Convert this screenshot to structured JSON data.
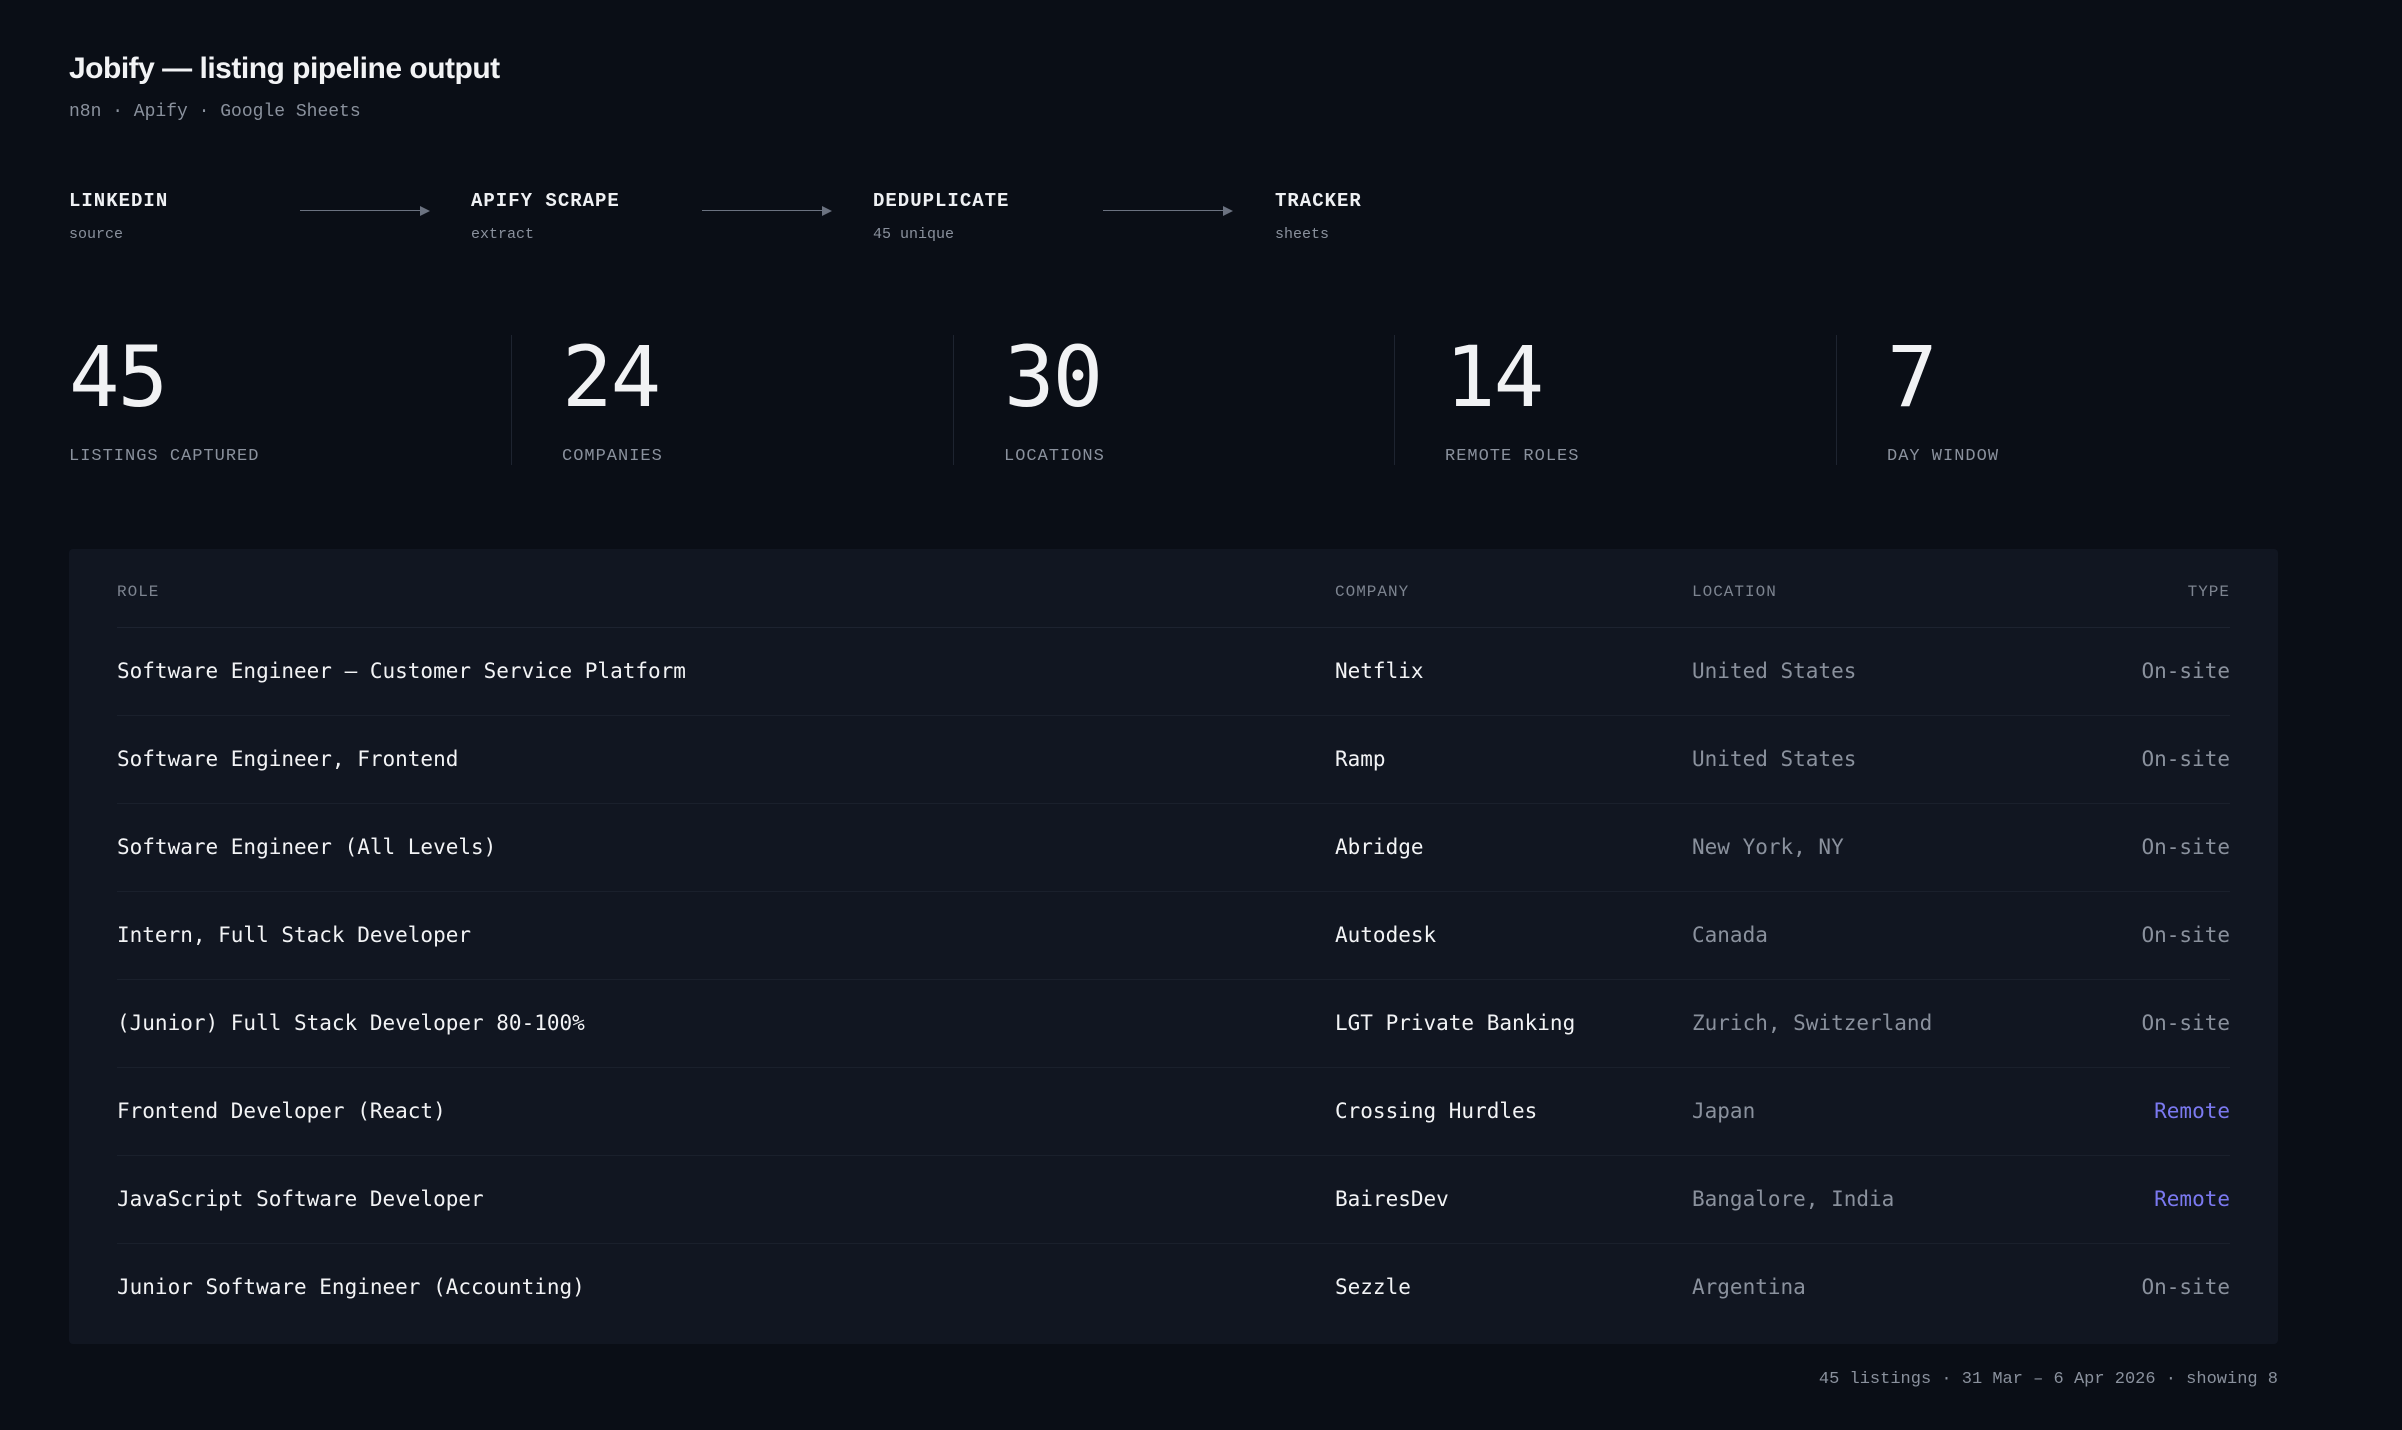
{
  "header": {
    "title": "Jobify — listing pipeline output",
    "subtitle": "n8n · Apify · Google Sheets"
  },
  "pipeline": {
    "stages": [
      {
        "name": "LINKEDIN",
        "sub": "source"
      },
      {
        "name": "APIFY SCRAPE",
        "sub": "extract"
      },
      {
        "name": "DEDUPLICATE",
        "sub": "45 unique"
      },
      {
        "name": "TRACKER",
        "sub": "sheets"
      }
    ]
  },
  "stats": [
    {
      "value": "45",
      "label": "LISTINGS CAPTURED"
    },
    {
      "value": "24",
      "label": "COMPANIES"
    },
    {
      "value": "30",
      "label": "LOCATIONS"
    },
    {
      "value": "14",
      "label": "REMOTE ROLES"
    },
    {
      "value": "7",
      "label": "DAY WINDOW"
    }
  ],
  "table": {
    "columns": {
      "role": "ROLE",
      "company": "COMPANY",
      "location": "LOCATION",
      "type": "TYPE"
    },
    "rows": [
      {
        "role": "Software Engineer – Customer Service Platform",
        "company": "Netflix",
        "location": "United States",
        "type": "On-site"
      },
      {
        "role": "Software Engineer, Frontend",
        "company": "Ramp",
        "location": "United States",
        "type": "On-site"
      },
      {
        "role": "Software Engineer (All Levels)",
        "company": "Abridge",
        "location": "New York, NY",
        "type": "On-site"
      },
      {
        "role": "Intern, Full Stack Developer",
        "company": "Autodesk",
        "location": "Canada",
        "type": "On-site"
      },
      {
        "role": "(Junior) Full Stack Developer 80-100%",
        "company": "LGT Private Banking",
        "location": "Zurich, Switzerland",
        "type": "On-site"
      },
      {
        "role": "Frontend Developer (React)",
        "company": "Crossing Hurdles",
        "location": "Japan",
        "type": "Remote"
      },
      {
        "role": "JavaScript Software Developer",
        "company": "BairesDev",
        "location": "Bangalore, India",
        "type": "Remote"
      },
      {
        "role": "Junior Software Engineer (Accounting)",
        "company": "Sezzle",
        "location": "Argentina",
        "type": "On-site"
      }
    ]
  },
  "footer": {
    "text": "45 listings · 31 Mar – 6 Apr 2026 · showing 8"
  },
  "colors": {
    "background": "#0a0e16",
    "card": "#111621",
    "remote_accent": "#7b79f0"
  }
}
